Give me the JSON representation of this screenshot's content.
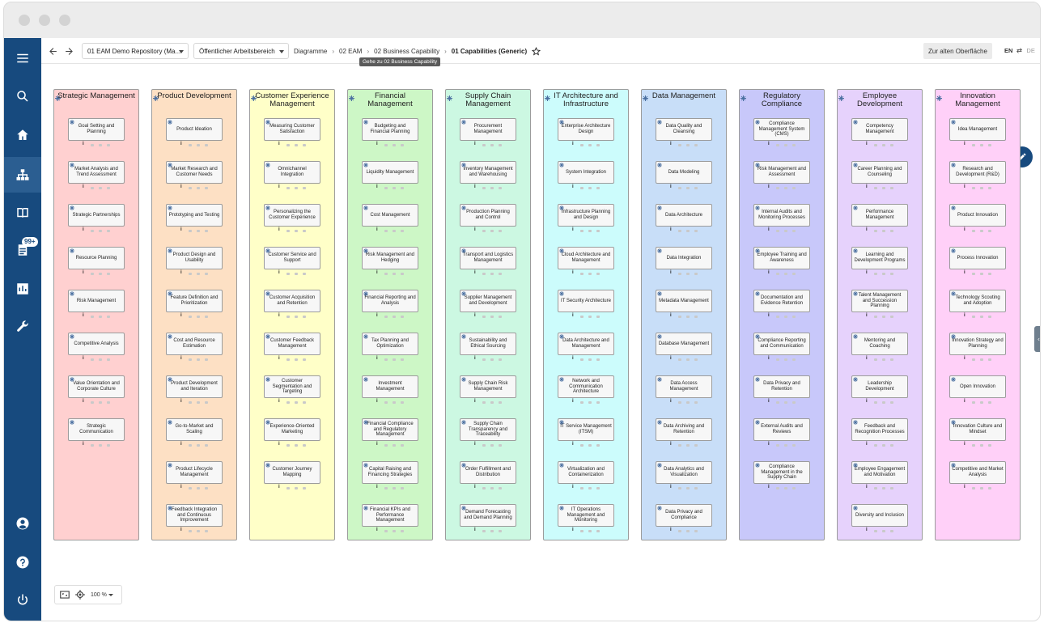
{
  "toolbar": {
    "repository": "01 EAM Demo Repository (Ma...",
    "workspace": "Öffentlicher Arbeitsbereich",
    "breadcrumb": [
      "Diagramme",
      "02 EAM",
      "02 Business Capability",
      "01 Capabilities (Generic)"
    ],
    "tooltip": "Gehe zu 02 Business Capability",
    "old_ui_label": "Zur alten Oberfläche",
    "lang_active": "EN",
    "lang_other": "DE"
  },
  "sidebar": {
    "badge": "99+"
  },
  "zoom": {
    "level": "100 %"
  },
  "colors": {
    "sidebar": "#174a7e",
    "columns": [
      "#ffd0d0",
      "#fde0c4",
      "#ffffc8",
      "#cdf7c6",
      "#ccf8e2",
      "#ccfcfc",
      "#c8def8",
      "#c8c8fa",
      "#e6d2fc",
      "#ffd0f8"
    ]
  },
  "columns": [
    {
      "title": "Strategic Management",
      "items": [
        "Goal Setting and Planning",
        "Market Analysis and Trend Assessment",
        "Strategic Partnerships",
        "Resource Planning",
        "Risk Management",
        "Competitive Analysis",
        "Value Orientation and Corporate Culture",
        "Strategic Communication"
      ]
    },
    {
      "title": "Product Development",
      "items": [
        "Product Ideation",
        "Market Research and Customer Needs",
        "Prototyping and Testing",
        "Product Design and Usability",
        "Feature Definition and Prioritization",
        "Cost and Resource Estimation",
        "Product Development and Iteration",
        "Go-to-Market and Scaling",
        "Product Lifecycle Management",
        "Feedback Integration and Continuous Improvement"
      ]
    },
    {
      "title": "Customer Experience Management",
      "items": [
        "Measuring Customer Satisfaction",
        "Omnichannel Integration",
        "Personalizing the Customer Experience",
        "Customer Service and Support",
        "Customer Acquisition and Retention",
        "Customer Feedback Management",
        "Customer Segmentation and Targeting",
        "Experience-Oriented Marketing",
        "Customer Journey Mapping"
      ]
    },
    {
      "title": "Financial Management",
      "items": [
        "Budgeting and Financial Planning",
        "Liquidity Management",
        "Cost Management",
        "Risk Management and Hedging",
        "Financial Reporting and Analysis",
        "Tax Planning and Optimization",
        "Investment Management",
        "Financial Compliance and Regulatory Management",
        "Capital Raising and Financing Strategies",
        "Financial KPIs and Performance Management"
      ]
    },
    {
      "title": "Supply Chain Management",
      "items": [
        "Procurement Management",
        "Inventory Management and Warehousing",
        "Production Planning and Control",
        "Transport and Logistics Management",
        "Supplier Management and Development",
        "Sustainability and Ethical Sourcing",
        "Supply Chain Risk Management",
        "Supply Chain Transparency and Traceability",
        "Order Fulfillment and Distribution",
        "Demand Forecasting and Demand Planning"
      ]
    },
    {
      "title": "IT Architecture and Infrastructure",
      "items": [
        "Enterprise Architecture Design",
        "System Integration",
        "Infrastructure Planning and Design",
        "Cloud Architecture and Management",
        "IT Security Architecture",
        "Data Architecture and Management",
        "Network and Communication Architecture",
        "IT Service Management (ITSM)",
        "Virtualization and Containerization",
        "IT Operations Management and Monitoring"
      ]
    },
    {
      "title": "Data Management",
      "items": [
        "Data Quality and Cleansing",
        "Data Modeling",
        "Data Architecture",
        "Data Integration",
        "Metadata Management",
        "Database Management",
        "Data Access Management",
        "Data Archiving and Retention",
        "Data Analytics and Visualization",
        "Data Privacy and Compliance"
      ]
    },
    {
      "title": "Regulatory Compliance",
      "items": [
        "Compliance Management System (CMS)",
        "Risk Management and Assessment",
        "Internal Audits and Monitoring Processes",
        "Employee Training and Awareness",
        "Documentation and Evidence Retention",
        "Compliance Reporting and Communication",
        "Data Privacy and Retention",
        "External Audits and Reviews",
        "Compliance Management in the Supply Chain"
      ]
    },
    {
      "title": "Employee Development",
      "items": [
        "Competency Management",
        "Career Planning and Counseling",
        "Performance Management",
        "Learning and Development Programs",
        "Talent Management and Succession Planning",
        "Mentoring and Coaching",
        "Leadership Development",
        "Feedback and Recognition Processes",
        "Employee Engagement and Motivation",
        "Diversity and Inclusion"
      ]
    },
    {
      "title": "Innovation Management",
      "items": [
        "Idea Management",
        "Research and Development (R&D)",
        "Product Innovation",
        "Process Innovation",
        "Technology Scouting and Adoption",
        "Innovation Strategy and Planning",
        "Open Innovation",
        "Innovation Culture and Mindset",
        "Competitive and Market Analysis"
      ]
    }
  ]
}
